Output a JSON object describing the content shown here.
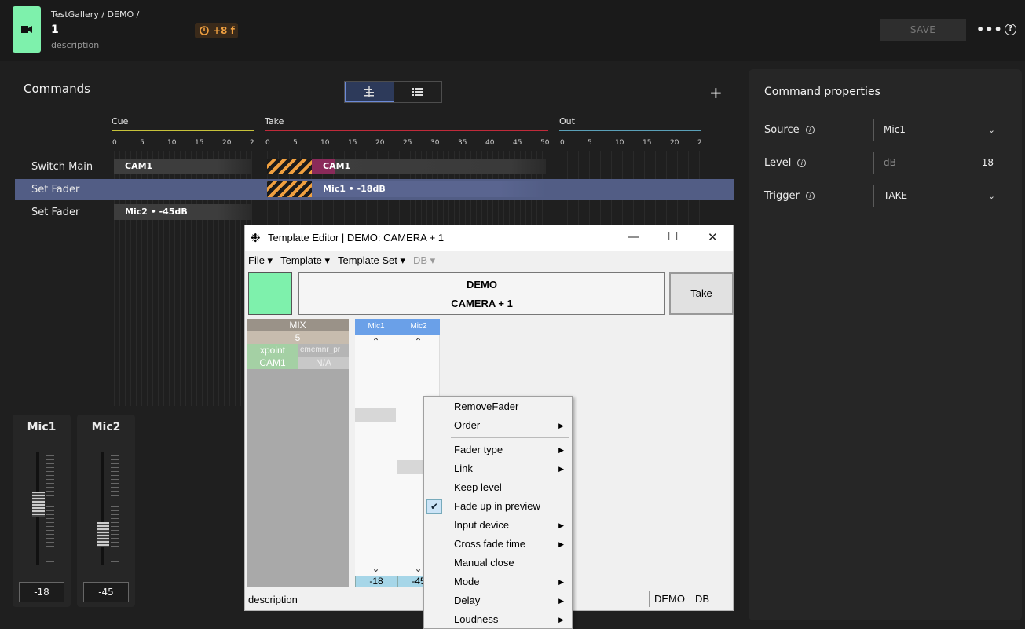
{
  "header": {
    "breadcrumb": "TestGallery / DEMO /",
    "title": "1",
    "description": "description",
    "timer": "+8 f",
    "save_label": "SAVE",
    "more": "•••",
    "help": "?"
  },
  "commands": {
    "title": "Commands",
    "add": "+",
    "phases": [
      {
        "name": "Cue",
        "color": "#c7c23a"
      },
      {
        "name": "Take",
        "color": "#c02a3a"
      },
      {
        "name": "Out",
        "color": "#5aa0b8"
      }
    ],
    "cue_ticks": [
      "0",
      "5",
      "10",
      "15",
      "20",
      "2"
    ],
    "take_ticks": [
      "0",
      "5",
      "10",
      "15",
      "20",
      "25",
      "30",
      "35",
      "40",
      "45",
      "50"
    ],
    "out_ticks": [
      "0",
      "5",
      "10",
      "15",
      "20",
      "2"
    ],
    "rows": [
      {
        "label": "Switch Main",
        "cue_bar": "CAM1",
        "take_bar": "CAM1"
      },
      {
        "label": "Set Fader",
        "take_bar": "Mic1 • -18dB",
        "selected": true
      },
      {
        "label": "Set Fader",
        "cue_bar": "Mic2 • -45dB"
      }
    ]
  },
  "faders": [
    {
      "name": "Mic1",
      "value": "-18",
      "level": 0.55
    },
    {
      "name": "Mic2",
      "value": "-45",
      "level": 0.2
    }
  ],
  "props": {
    "title": "Command properties",
    "source_label": "Source",
    "source_value": "Mic1",
    "level_label": "Level",
    "level_unit": "dB",
    "level_value": "-18",
    "trigger_label": "Trigger",
    "trigger_value": "TAKE"
  },
  "editor": {
    "title": "Template Editor | DEMO: CAMERA + 1",
    "menu": [
      "File ▾",
      "Template ▾",
      "Template Set ▾",
      "DB ▾"
    ],
    "name_line1": "DEMO",
    "name_line2": "CAMERA + 1",
    "take_label": "Take",
    "mix_header": "MIX",
    "mix_num": "5",
    "xpoint_label": "xpoint",
    "xpoint_value": "ememnr_pr",
    "cam_label": "CAM1",
    "cam_value": "N/A",
    "tab_mic1": "Mic1",
    "tab_mic2": "Mic2",
    "val_mic1": "-18",
    "val_mic2": "-45",
    "status": "description",
    "status_demo": "DEMO",
    "status_db": "DB"
  },
  "context_menu": {
    "items": [
      {
        "label": "RemoveFader",
        "sub": false
      },
      {
        "label": "Order",
        "sub": true
      },
      {
        "label": "Fader type",
        "sub": true
      },
      {
        "label": "Link",
        "sub": true
      },
      {
        "label": "Keep level",
        "sub": false
      },
      {
        "label": "Fade up in preview",
        "sub": false,
        "checked": true
      },
      {
        "label": "Input device",
        "sub": true
      },
      {
        "label": "Cross fade time",
        "sub": true
      },
      {
        "label": "Manual close",
        "sub": false
      },
      {
        "label": "Mode",
        "sub": true
      },
      {
        "label": "Delay",
        "sub": true
      },
      {
        "label": "Loudness",
        "sub": true
      }
    ]
  }
}
